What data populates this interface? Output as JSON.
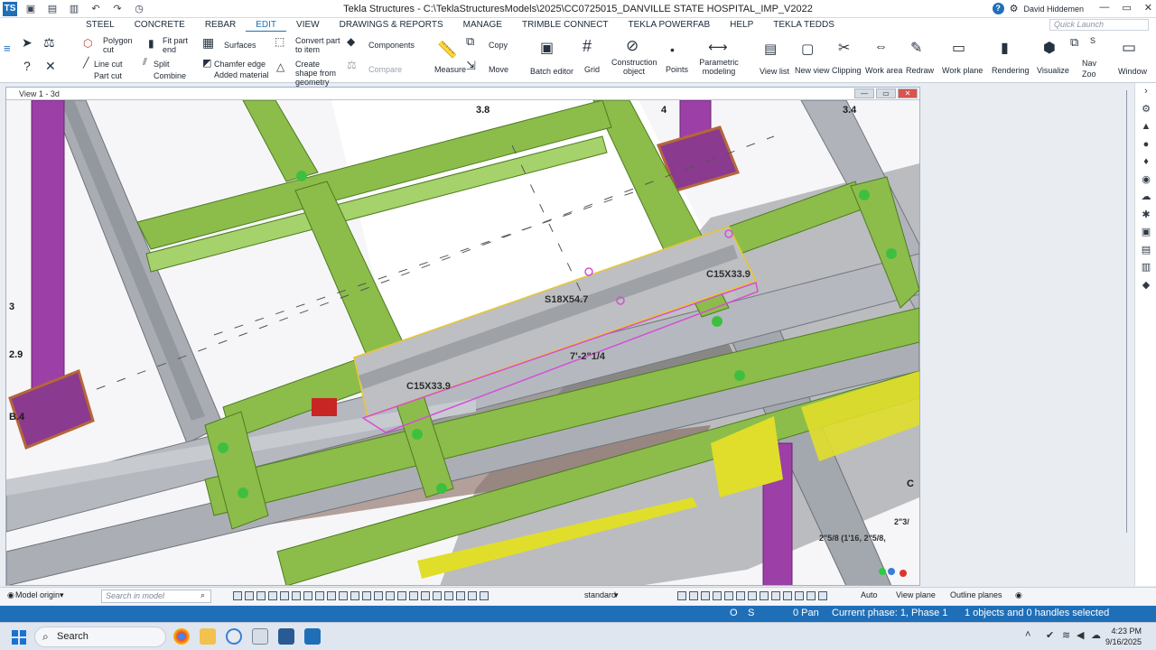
{
  "titlebar": {
    "app_logo": "TS",
    "title": "Tekla Structures - C:\\TeklaStructuresModels\\2025\\CC0725015_DANVILLE STATE HOSPITAL_IMP_V2022",
    "user": "David Hiddemen",
    "help_icon": "?",
    "window_controls": [
      "—",
      "▭",
      "✕"
    ]
  },
  "menu": {
    "tabs": [
      "STEEL",
      "CONCRETE",
      "REBAR",
      "EDIT",
      "VIEW",
      "DRAWINGS & REPORTS",
      "MANAGE",
      "TRIMBLE CONNECT",
      "TEKLA POWERFAB",
      "HELP",
      "TEKLA TEDDS"
    ],
    "active_tab": "EDIT",
    "quick_launch_placeholder": "Quick Launch"
  },
  "ribbon": {
    "polygon_cut": "Polygon cut",
    "fit_part_end": "Fit part end",
    "surfaces": "Surfaces",
    "convert_part": "Convert part to item",
    "components": "Components",
    "copy": "Copy",
    "line_cut": "Line cut",
    "split": "Split",
    "chamfer_edge": "Chamfer edge",
    "create_shape": "Create shape from geometry",
    "compare": "Compare",
    "measure": "Measure",
    "move": "Move",
    "batch_editor": "Batch editor",
    "grid": "Grid",
    "construction_object": "Construction object",
    "points": "Points",
    "parametric_modeling": "Parametric modeling",
    "part_cut": "Part cut",
    "combine": "Combine",
    "added_material": "Added material",
    "view_list": "View list",
    "new_view": "New view",
    "clipping": "Clipping",
    "work_area": "Work area",
    "redraw": "Redraw",
    "work_plane": "Work plane",
    "rendering": "Rendering",
    "visualize": "Visualize",
    "small_s": "S",
    "nav": "Nav",
    "zoo": "Zoo",
    "window": "Window"
  },
  "view": {
    "title": "View 1 - 3d",
    "grid_labels": [
      "3.8",
      "4",
      "3.4",
      "3",
      "2.9",
      "B.4",
      "C"
    ],
    "part_labels": [
      "C15X33.9",
      "S18X54.7",
      "C15X33.9"
    ],
    "dimension": "7'-2\"1/4",
    "dim_right_1": "2\"3/",
    "dim_right_2": "2\"5/8 (1'16, 2\"5/8,"
  },
  "bottom": {
    "model_origin": "Model origin",
    "search_placeholder": "Search in model",
    "view_filter": "standard",
    "auto": "Auto",
    "view_plane": "View plane",
    "outline_planes": "Outline planes"
  },
  "status": {
    "o": "O",
    "s": "S",
    "pan": "0 Pan",
    "phase": "Current phase: 1, Phase 1",
    "selection": "1 objects and 0 handles selected"
  },
  "taskbar": {
    "search": "Search",
    "time": "4:23 PM",
    "date": "9/16/2025"
  },
  "colors": {
    "accent": "#1f6fb8",
    "beam_green": "#8cbd4a",
    "column_purple": "#9c3fa6",
    "steel_gray": "#a7acb3",
    "selection_yellow": "#e8c630",
    "pointcloud_yellow": "#e0de2a"
  }
}
